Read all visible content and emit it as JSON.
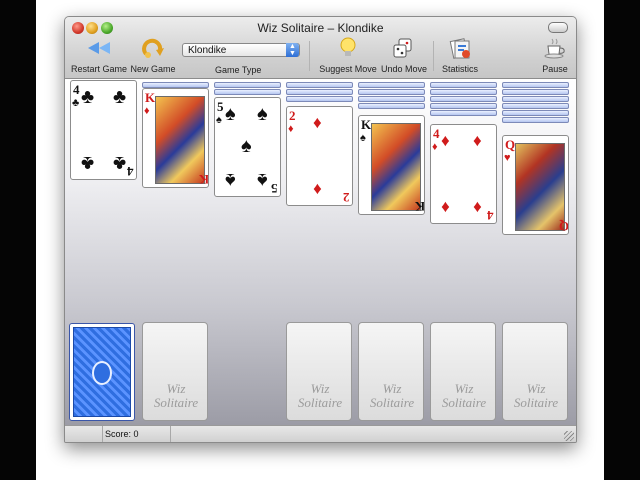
{
  "window": {
    "title": "Wiz Solitaire – Klondike"
  },
  "toolbar": {
    "restart_label": "Restart Game",
    "new_label": "New Game",
    "game_type_label": "Game Type",
    "game_type_value": "Klondike",
    "suggest_label": "Suggest Move",
    "undo_label": "Undo Move",
    "stats_label": "Statistics",
    "pause_label": "Pause"
  },
  "tableau": [
    {
      "rank": "4",
      "suit": "♣",
      "color": "black",
      "face_down": 0
    },
    {
      "rank": "K",
      "suit": "♦",
      "color": "red",
      "face_down": 1
    },
    {
      "rank": "5",
      "suit": "♠",
      "color": "black",
      "face_down": 2
    },
    {
      "rank": "2",
      "suit": "♦",
      "color": "red",
      "face_down": 3
    },
    {
      "rank": "K",
      "suit": "♠",
      "color": "black",
      "face_down": 4
    },
    {
      "rank": "4",
      "suit": "♦",
      "color": "red",
      "face_down": 5
    },
    {
      "rank": "Q",
      "suit": "♥",
      "color": "red",
      "face_down": 6
    }
  ],
  "slots": {
    "watermark_line1": "Wiz",
    "watermark_line2": "Solitaire"
  },
  "status": {
    "score_text": "Score: 0"
  },
  "colors": {
    "accent_blue": "#2f6ee0",
    "red_suit": "#d01b1b"
  }
}
